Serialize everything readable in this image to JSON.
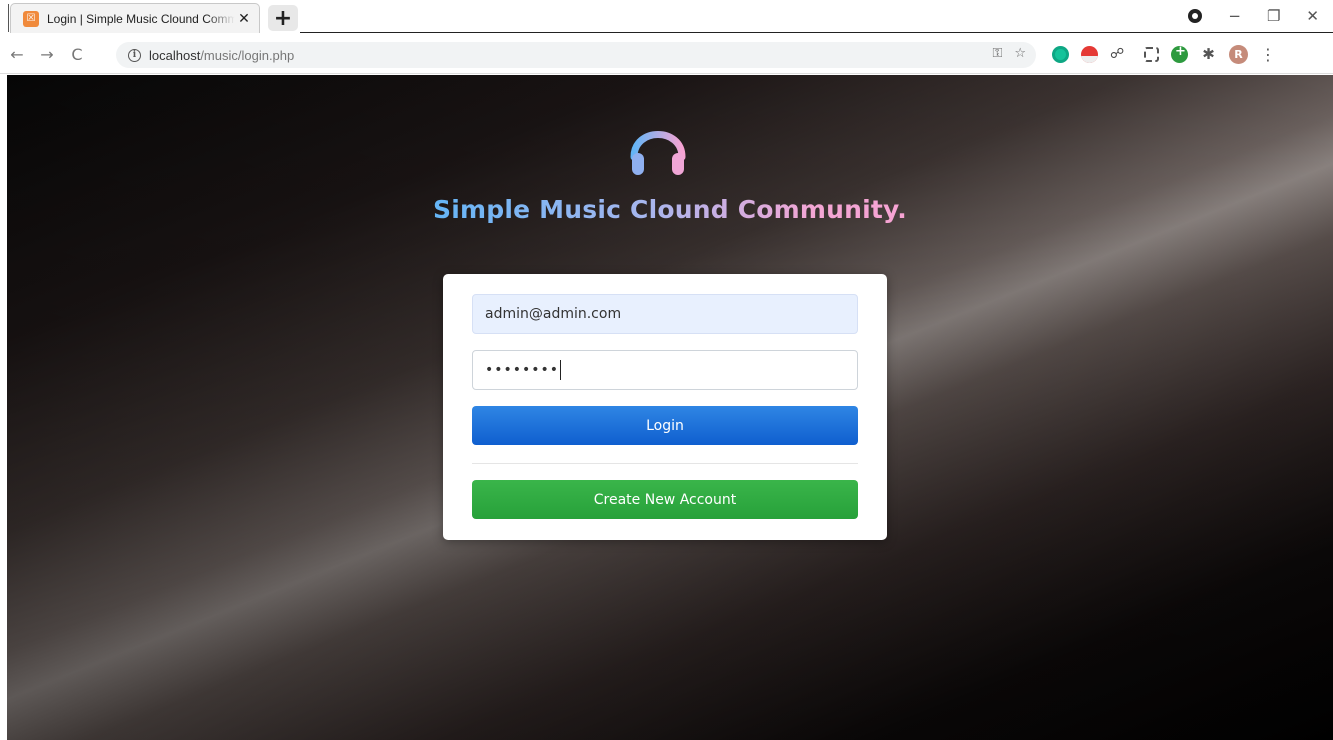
{
  "browser": {
    "tab": {
      "favicon_glyph": "☒",
      "title": "Login | Simple Music Clound Community",
      "close_glyph": "✕"
    },
    "new_tab_glyph": "+",
    "window_controls": {
      "minimize": "−",
      "restore": "❐",
      "close": "✕"
    },
    "nav": {
      "back": "←",
      "forward": "→",
      "reload": "C"
    },
    "address": {
      "host": "localhost",
      "path": "/music/login.php"
    },
    "omnibox_icons": {
      "key": "⚿",
      "star": "☆"
    },
    "extensions": [
      "grammarly-icon",
      "pokeball-icon",
      "capture-icon",
      "screenshot-icon",
      "add-icon",
      "puzzle-icon"
    ],
    "profile_initial": "R",
    "menu_glyph": "⋮"
  },
  "page": {
    "brand_title": "Simple Music Clound Community.",
    "logo_icon": "headphones-icon",
    "gradient_colors": [
      "#64b5f6",
      "#f6a3d3"
    ],
    "login_form": {
      "email_value": "admin@admin.com",
      "password_mask": "••••••••",
      "login_label": "Login",
      "create_account_label": "Create New Account"
    },
    "colors": {
      "login_button": "#1a6fdc",
      "create_button": "#2fa843"
    }
  }
}
